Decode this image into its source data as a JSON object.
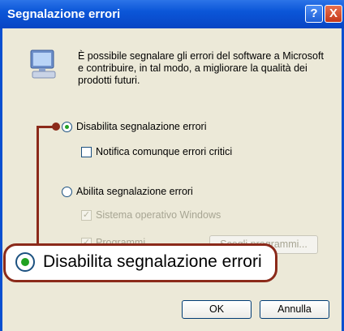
{
  "window": {
    "title": "Segnalazione errori",
    "help_glyph": "?",
    "close_glyph": "X"
  },
  "description": "È possibile segnalare gli errori del software a Microsoft e contribuire, in tal modo, a migliorare la qualità dei prodotti futuri.",
  "options": {
    "disable_label": "Disabilita segnalazione errori",
    "notify_label": "Notifica comunque errori critici",
    "enable_label": "Abilita segnalazione errori",
    "os_label": "Sistema operativo Windows",
    "programs_label": "Programmi",
    "choose_programs_label": "Scegli programmi..."
  },
  "callout": {
    "label": "Disabilita segnalazione errori"
  },
  "buttons": {
    "ok": "OK",
    "cancel": "Annulla"
  },
  "icons": {
    "computer": "computer-icon"
  }
}
